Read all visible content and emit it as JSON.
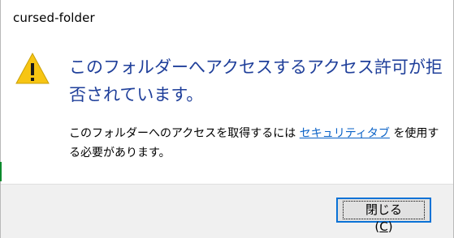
{
  "window": {
    "title": "cursed-folder"
  },
  "icons": {
    "warning": "warning-icon"
  },
  "main": {
    "instruction": "このフォルダーへアクセスするアクセス許可が拒否されています。",
    "content_before_link": "このフォルダーへのアクセスを取得するには ",
    "link_text": "セキュリティタブ",
    "content_after_link": " を使用する必要があります。"
  },
  "footer": {
    "close_label": "閉じる(",
    "close_accel": "C",
    "close_label_end": ")"
  },
  "colors": {
    "instruction": "#1f3f9a",
    "link": "#0a62c7",
    "footer_bg": "#f0f0f0",
    "button_focus_border": "#0a72d6"
  }
}
